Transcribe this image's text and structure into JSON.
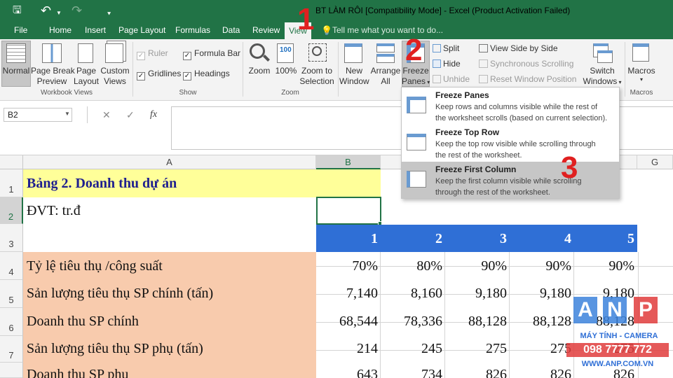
{
  "window": {
    "title": "BT LÀM RÔI  [Compatibility Mode] - Excel (Product Activation Failed)"
  },
  "qat": {
    "save_glyph": "🖫",
    "undo_glyph": "↶",
    "redo_glyph": "↷",
    "more_glyph": "⯆"
  },
  "tabs": [
    "File",
    "Home",
    "Insert",
    "Page Layout",
    "Formulas",
    "Data",
    "Review",
    "View"
  ],
  "tell_me": "Tell me what you want to do...",
  "ribbon": {
    "workbook_views": {
      "label": "Workbook Views",
      "normal": "Normal",
      "page_break_1": "Page Break",
      "page_break_2": "Preview",
      "page_layout_1": "Page",
      "page_layout_2": "Layout",
      "custom_1": "Custom",
      "custom_2": "Views"
    },
    "show": {
      "label": "Show",
      "ruler": "Ruler",
      "formula_bar": "Formula Bar",
      "gridlines": "Gridlines",
      "headings": "Headings"
    },
    "zoom": {
      "label": "Zoom",
      "zoom": "Zoom",
      "hundred": "100%",
      "zoom_sel_1": "Zoom to",
      "zoom_sel_2": "Selection"
    },
    "window": {
      "new_1": "New",
      "new_2": "Window",
      "arrange_1": "Arrange",
      "arrange_2": "All",
      "freeze_1": "Freeze",
      "freeze_2": "Panes",
      "split": "Split",
      "hide": "Hide",
      "unhide": "Unhide",
      "side_by_side": "View Side by Side",
      "sync_scroll": "Synchronous Scrolling",
      "reset_pos": "Reset Window Position",
      "switch_1": "Switch",
      "switch_2": "Windows"
    },
    "macros": {
      "label": "Macros",
      "btn": "Macros"
    }
  },
  "formula_bar": {
    "name_box": "B2",
    "fx": "fx",
    "cancel": "✕",
    "enter": "✓"
  },
  "columns": [
    "A",
    "B",
    "G"
  ],
  "rows": [
    "1",
    "2",
    "3",
    "4",
    "5",
    "6",
    "7"
  ],
  "sheet": {
    "a1": "Bảng 2. Doanh thu dự án",
    "a2": "ĐVT: tr.đ",
    "header_nums": [
      "1",
      "2",
      "3",
      "4",
      "5"
    ],
    "row4": {
      "label": "Tỷ lệ tiêu thụ /công suất",
      "values": [
        "70%",
        "80%",
        "90%",
        "90%",
        "90%"
      ]
    },
    "row5": {
      "label": "Sản lượng tiêu thụ SP chính (tấn)",
      "values": [
        "7,140",
        "8,160",
        "9,180",
        "9,180",
        "9,180"
      ]
    },
    "row6": {
      "label": "Doanh thu SP chính",
      "values": [
        "68,544",
        "78,336",
        "88,128",
        "88,128",
        "88,128"
      ]
    },
    "row7": {
      "label": "Sản lượng tiêu thụ SP phụ (tấn)",
      "values": [
        "214",
        "245",
        "275",
        "275",
        "275"
      ]
    },
    "row8": {
      "label": "Doanh thu SP phụ",
      "values": [
        "643",
        "734",
        "826",
        "826",
        "826"
      ]
    }
  },
  "freeze_menu": {
    "items": [
      {
        "title": "Freeze Panes",
        "desc1": "Keep rows and columns visible while the rest of",
        "desc2": "the worksheet scrolls (based on current selection)."
      },
      {
        "title": "Freeze Top Row",
        "desc1": "Keep the top row visible while scrolling through",
        "desc2": "the rest of the worksheet."
      },
      {
        "title": "Freeze First Column",
        "desc1": "Keep the first column visible while scrolling",
        "desc2": "through the rest of the worksheet."
      }
    ]
  },
  "steps": [
    "1",
    "2",
    "3"
  ],
  "watermark": {
    "letters": [
      "A",
      "N",
      "P"
    ],
    "line1": "MÁY TÍNH - CAMERA",
    "line2": "098 7777 772",
    "line3": "WWW.ANP.COM.VN"
  },
  "colors": {
    "excel_green": "#217346",
    "header_blue": "#2f6fd6",
    "label_peach": "#f8cbad",
    "title_yellow": "#ffff99",
    "step_red": "#e02020"
  }
}
